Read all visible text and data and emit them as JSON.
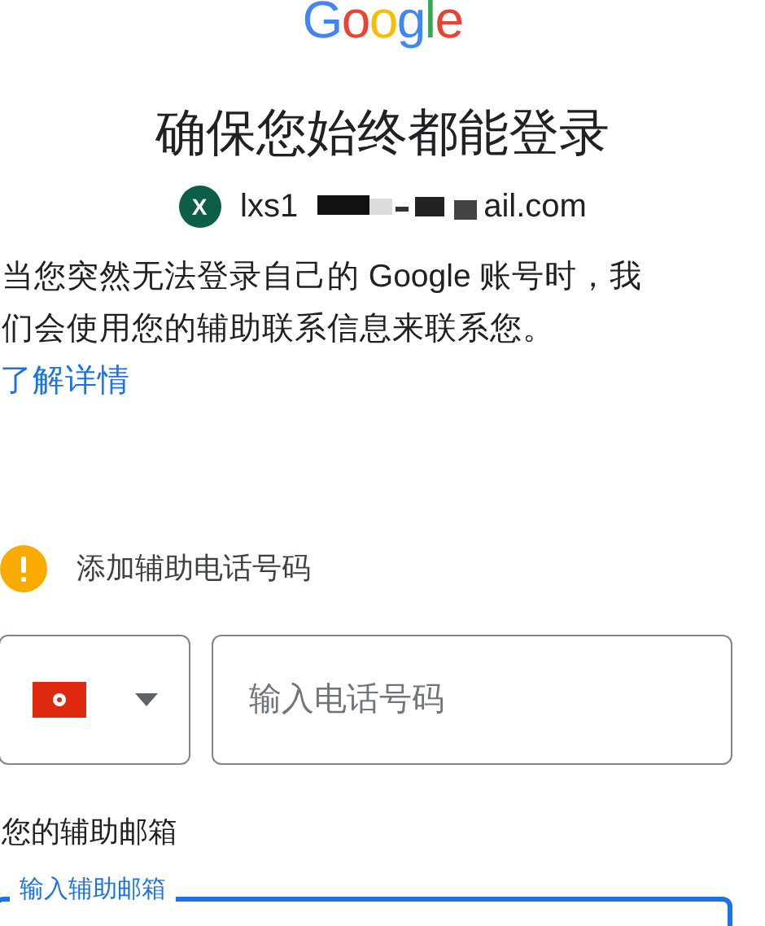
{
  "logo": "Google",
  "title": "确保您始终都能登录",
  "account": {
    "avatar_letter": "X",
    "email_start": "lxs1",
    "email_end": "ail.com"
  },
  "description": "当您突然无法登录自己的 Google 账号时，我们会使用您的辅助联系信息来联系您。",
  "learn_more_link": "了解详情",
  "warning": "添加辅助电话号码",
  "phone": {
    "placeholder": "输入电话号码"
  },
  "recovery_email": {
    "heading": "您的辅助邮箱",
    "label": "输入辅助邮箱",
    "focused": true
  }
}
